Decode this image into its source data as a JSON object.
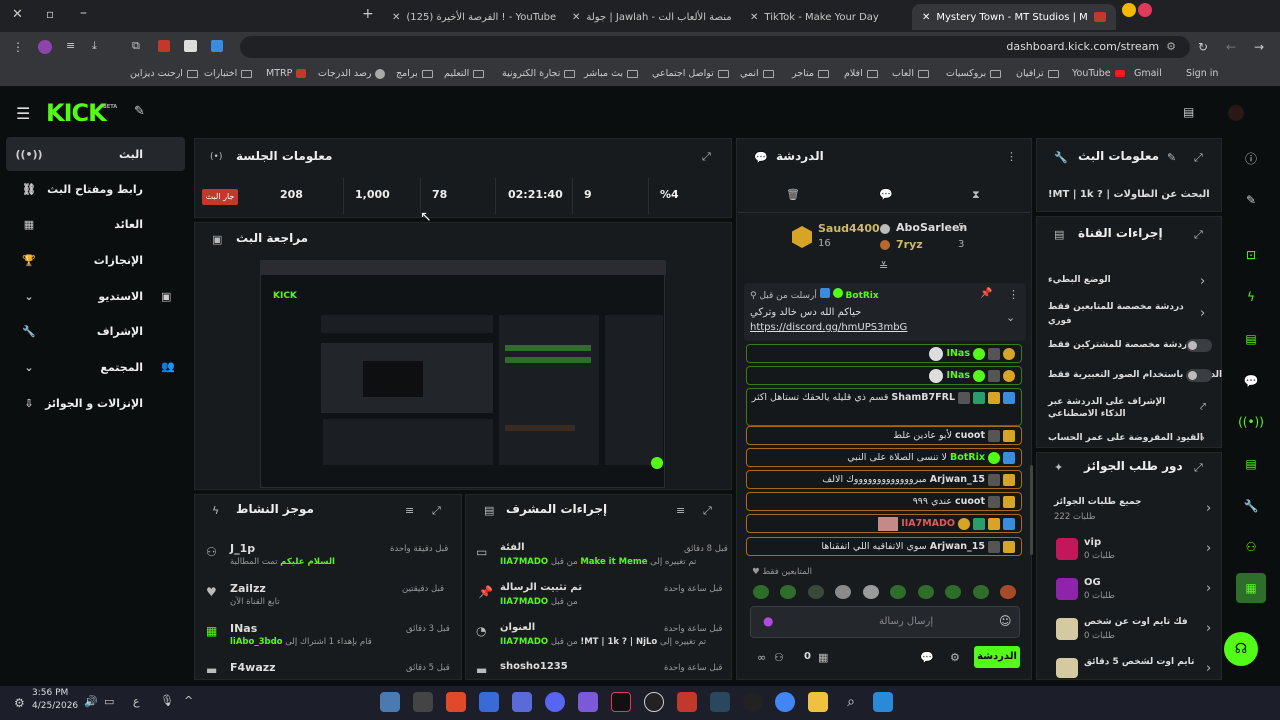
{
  "browser": {
    "tabs": [
      {
        "label": "Mystery Town - MT Studios | M"
      },
      {
        "label": "TikTok - Make Your Day"
      },
      {
        "label": "جولة | Jawlah - منصة الألعاب الت"
      },
      {
        "label": "(125) الفرصة الأخيرة ! - YouTube"
      }
    ],
    "url": "dashboard.kick.com/stream",
    "bookmarks": [
      "Sign in",
      "Gmail",
      "YouTube",
      "ترافيان",
      "بروكسيات",
      "العاب",
      "افلام",
      "متاجر",
      "انمي",
      "تواصل اجتماعي",
      "بث مباشر",
      "تجارة الكترونية",
      "التعليم",
      "برامج",
      "رصد الدرجات",
      "MTRP",
      "اختبارات",
      "ارحنت ديزاين"
    ]
  },
  "sidebar": {
    "items": [
      {
        "label": "البث"
      },
      {
        "label": "رابط ومفتاح البث"
      },
      {
        "label": "العائد"
      },
      {
        "label": "الإنجازات"
      },
      {
        "label": "الاستديو"
      },
      {
        "label": "الإشراف"
      },
      {
        "label": "المجتمع"
      },
      {
        "label": "الإنزالات و الجوائز"
      }
    ]
  },
  "session": {
    "title": "معلومات الجلسة",
    "stats": [
      "%4",
      "9",
      "02:21:40",
      "78",
      "1,000",
      "208"
    ],
    "live_badge": "جار البث"
  },
  "preview": {
    "title": "مراجعة البث"
  },
  "activity": {
    "title": "موجز النشاط",
    "items": [
      {
        "name": "J_1p",
        "time": "قبل دقيقة واحدة",
        "desc_pre": "تمت المطالبة",
        "desc_hl": "السلام عليكم"
      },
      {
        "name": "Zailzz",
        "time": "قبل دقيقتين",
        "desc_pre": "تابع القناة الآن",
        "desc_hl": ""
      },
      {
        "name": "INas",
        "time": "قبل 3 دقائق",
        "desc_pre": "قام بإهداء 1 اشتراك إلى",
        "desc_hl": "liAbo_3bdo"
      },
      {
        "name": "F4wazz",
        "time": "قبل 5 دقائق",
        "desc_pre": "",
        "desc_hl": ""
      }
    ]
  },
  "modactions": {
    "title": "إجراءات المشرف",
    "items": [
      {
        "title": "الفئة",
        "time": "قبل 8 دقائق",
        "desc_pre": "تم تغييره إلى",
        "hl1": "Make it Meme",
        "mid": "من قبل",
        "hl2": "IIA7MADO"
      },
      {
        "title": "تم تثبيت الرسالة",
        "time": "قبل ساعة واحدة",
        "desc_pre": "من قبل",
        "hl1": "IIA7MADO",
        "mid": "",
        "hl2": ""
      },
      {
        "title": "العنوان",
        "time": "قبل ساعة واحدة",
        "desc_pre": "تم تغييره إلى",
        "hl1": "!MT | 1k ? | NjLo",
        "mid": "من قبل",
        "hl2": "IIA7MADO"
      },
      {
        "title": "shosho1235",
        "time": "قبل ساعة واحدة",
        "desc_pre": "",
        "hl1": "",
        "mid": "",
        "hl2": ""
      }
    ]
  },
  "chat": {
    "title": "الدردشة",
    "top": [
      {
        "name": "Saud4400",
        "count": "16"
      },
      {
        "name": "AboSarleen",
        "count": "5"
      },
      {
        "name": "7ryz",
        "count": "3"
      }
    ],
    "pinned": {
      "header": "أرسلت من قبل",
      "user": "BotRix",
      "text": "حياكم الله دس خالد وتركي",
      "link": "https://discord.gg/hmUPS3mbG"
    },
    "messages": [
      {
        "user": "INas",
        "text": ""
      },
      {
        "user": "INas",
        "text": ""
      },
      {
        "user": "ShamB7FRL",
        "text": "قسم ذي قليله يالحقك تستاهل اكثر"
      },
      {
        "user": "cuoot",
        "text": "لأبو عادين غلط"
      },
      {
        "user": "BotRix",
        "text": "لا تنسى الصلاة على النبي"
      },
      {
        "user": "Arjwan_15",
        "text": "مبروووووووووووووك الالف"
      },
      {
        "user": "cuoot",
        "text": "عندي ٩٩٩"
      },
      {
        "user": "IIA7MADO",
        "text": ""
      },
      {
        "user": "Arjwan_15",
        "text": "سوي الاتفاقيه اللي اتفقناها"
      }
    ],
    "followers_only": "المتابعين فقط",
    "input_placeholder": "إرسال رسالة",
    "send_label": "الدردشة",
    "viewer_count": "0"
  },
  "streaminfo": {
    "title": "معلومات البث",
    "stream_title": "!MT | 1k ? | البحث عن الطاولات"
  },
  "channelactions": {
    "title": "إجراءات القناة",
    "items": [
      {
        "label": "الوضع البطيء",
        "sub": ""
      },
      {
        "label": "دردشة مخصصة للمتابعين فقط",
        "sub": "فوري"
      },
      {
        "label": "الدردشة مخصصة للمشتركين فقط",
        "sub": ""
      },
      {
        "label": "الدردشة باستخدام الصور التعبيرية فقط",
        "sub": ""
      },
      {
        "label": "الإشراف على الدردشة عبر الذكاء الاصطناعي",
        "sub": ""
      },
      {
        "label": "القيود المفروضة على عمر الحساب",
        "sub": ""
      }
    ]
  },
  "rewards": {
    "title": "دور طلب الجوائز",
    "items": [
      {
        "label": "جميع طلبات الجوائز",
        "sub": "222 طلبات"
      },
      {
        "label": "vip",
        "sub": "0 طلبات"
      },
      {
        "label": "OG",
        "sub": "0 طلبات"
      },
      {
        "label": "فك تايم اوت عن شخص",
        "sub": "0 طلبات"
      },
      {
        "label": "تايم اوت لشخص 5 دقائق",
        "sub": ""
      }
    ]
  },
  "taskbar": {
    "time": "3:56 PM",
    "date": "4/25/2026",
    "lang": "ع"
  },
  "colors": {
    "accent": "#53fc18",
    "bg": "#0b0e0f",
    "panel": "#181b1e"
  }
}
